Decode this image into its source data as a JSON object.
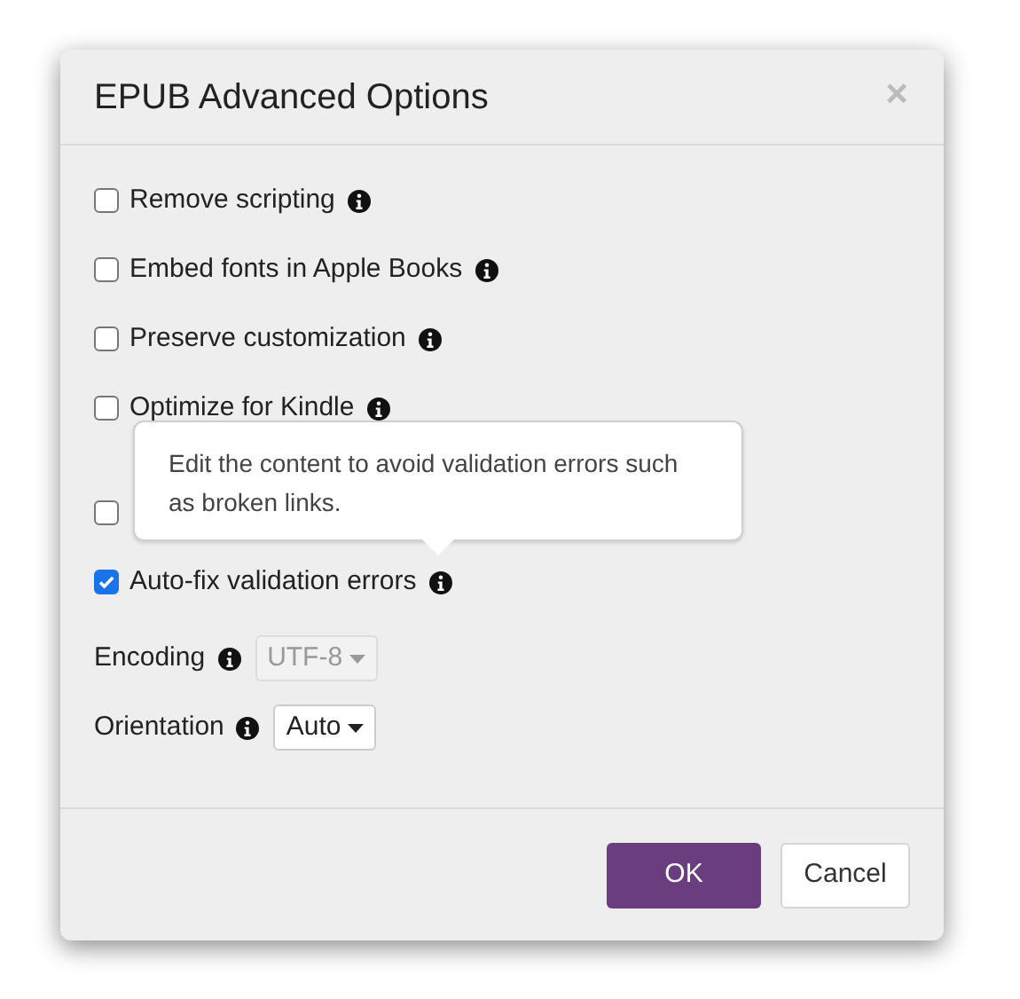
{
  "dialog": {
    "title": "EPUB Advanced Options",
    "close": "×"
  },
  "options": [
    {
      "label": "Remove scripting",
      "checked": false
    },
    {
      "label": "Embed fonts in Apple Books",
      "checked": false
    },
    {
      "label": "Preserve customization",
      "checked": false
    },
    {
      "label": "Optimize for Kindle",
      "checked": false
    },
    {
      "checked": false
    },
    {
      "label": "Auto-fix validation errors",
      "checked": true
    }
  ],
  "selects": [
    {
      "label": "Encoding",
      "value": "UTF-8",
      "disabled": true
    },
    {
      "label": "Orientation",
      "value": "Auto",
      "disabled": false
    }
  ],
  "tooltip": {
    "text": "Edit the content to avoid validation errors such as broken links."
  },
  "buttons": [
    {
      "label": "OK",
      "kind": "primary"
    },
    {
      "label": "Cancel",
      "kind": "secondary"
    }
  ]
}
